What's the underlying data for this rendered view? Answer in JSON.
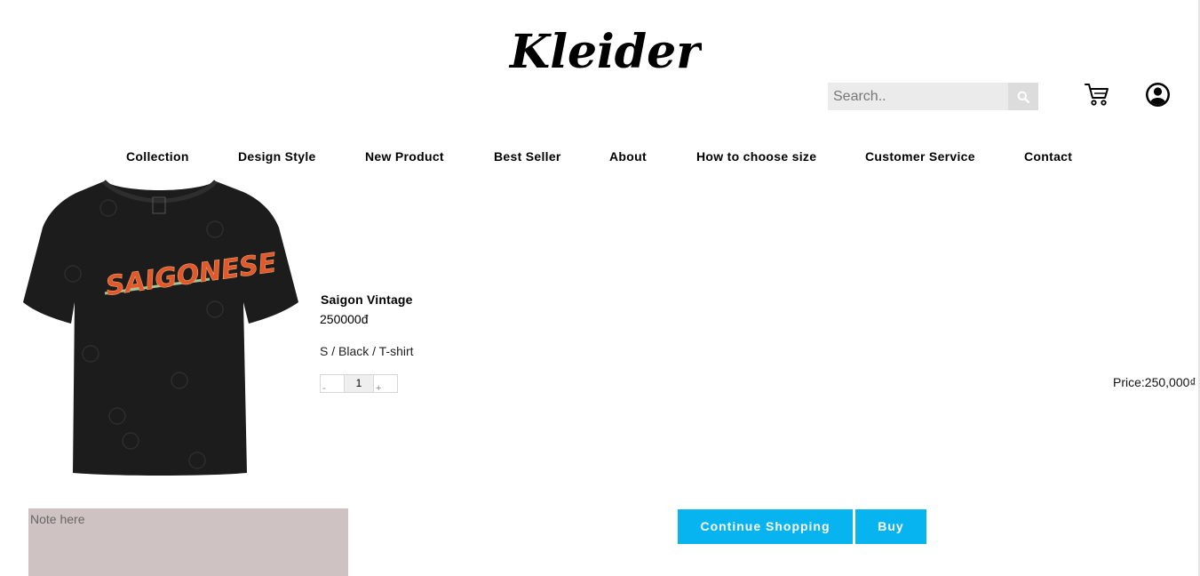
{
  "brand": {
    "logo_text": "Kleider"
  },
  "header": {
    "search": {
      "placeholder": "Search..",
      "value": ""
    },
    "icons": {
      "search": "search-icon",
      "cart": "cart-icon",
      "account": "user-circle-icon"
    }
  },
  "nav": {
    "items": [
      "Collection",
      "Design Style",
      "New Product",
      "Best Seller",
      "About",
      "How to choose size",
      "Customer Service",
      "Contact"
    ]
  },
  "product": {
    "image_text": "SAIGONESE",
    "name": "Saigon Vintage",
    "price": "250000đ",
    "variant": "S / Black / T-shirt",
    "quantity": {
      "minus": "-",
      "value": "1",
      "plus": "+"
    },
    "line_total": "Price:250,000₫"
  },
  "cart": {
    "note_placeholder": "Note here",
    "continue_label": "Continue Shopping",
    "buy_label": "Buy"
  },
  "colors": {
    "accent": "#08b4f0",
    "note_bg": "#cec2c2",
    "search_bg": "#ebebeb",
    "shirt": "#1c1c1c",
    "print_orange": "#e0582b"
  }
}
